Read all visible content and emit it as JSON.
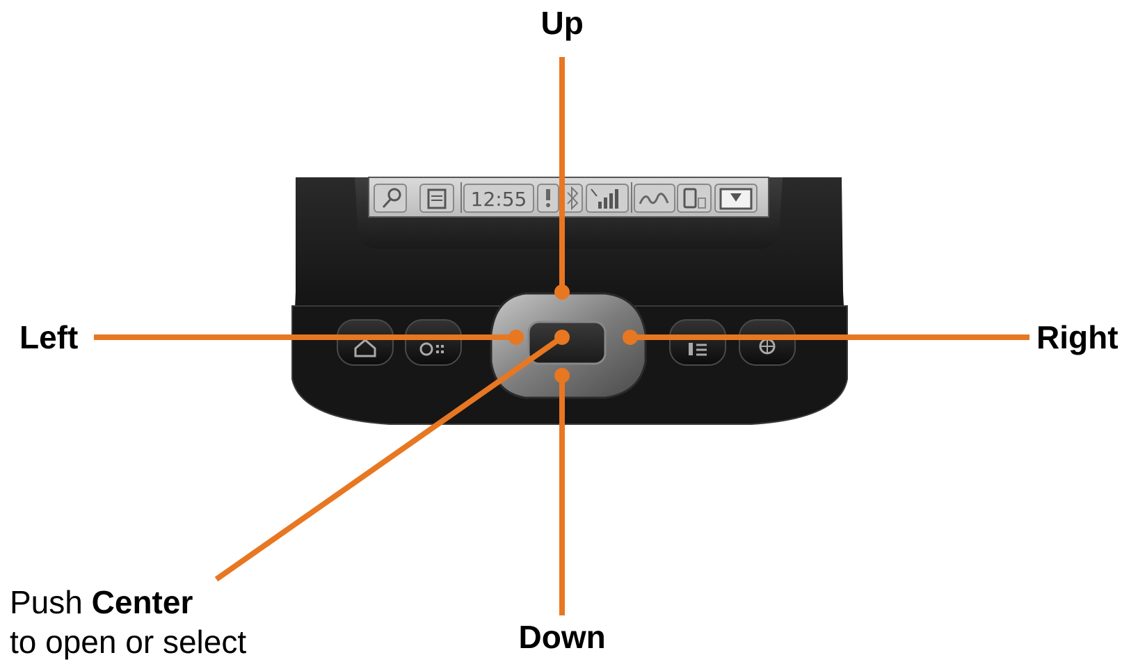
{
  "labels": {
    "up": "Up",
    "left": "Left",
    "right": "Right",
    "down": "Down"
  },
  "center_note": {
    "prefix": "Push ",
    "bold": "Center",
    "line2": "to open or select"
  },
  "device": {
    "status_bar_time": "12:55",
    "status_bar_icons": [
      "search-icon",
      "notes-icon",
      "alert-icon",
      "bluetooth-icon",
      "signal-icon",
      "graffiti-icon",
      "device-icon",
      "input-tray-icon"
    ],
    "buttons_left": [
      "home-icon",
      "calendar-icon"
    ],
    "buttons_right": [
      "contacts-icon",
      "web-icon"
    ]
  },
  "colors": {
    "callout": "#E87722",
    "device_body": "#111111",
    "nav_ring": "#8a8a8a"
  }
}
